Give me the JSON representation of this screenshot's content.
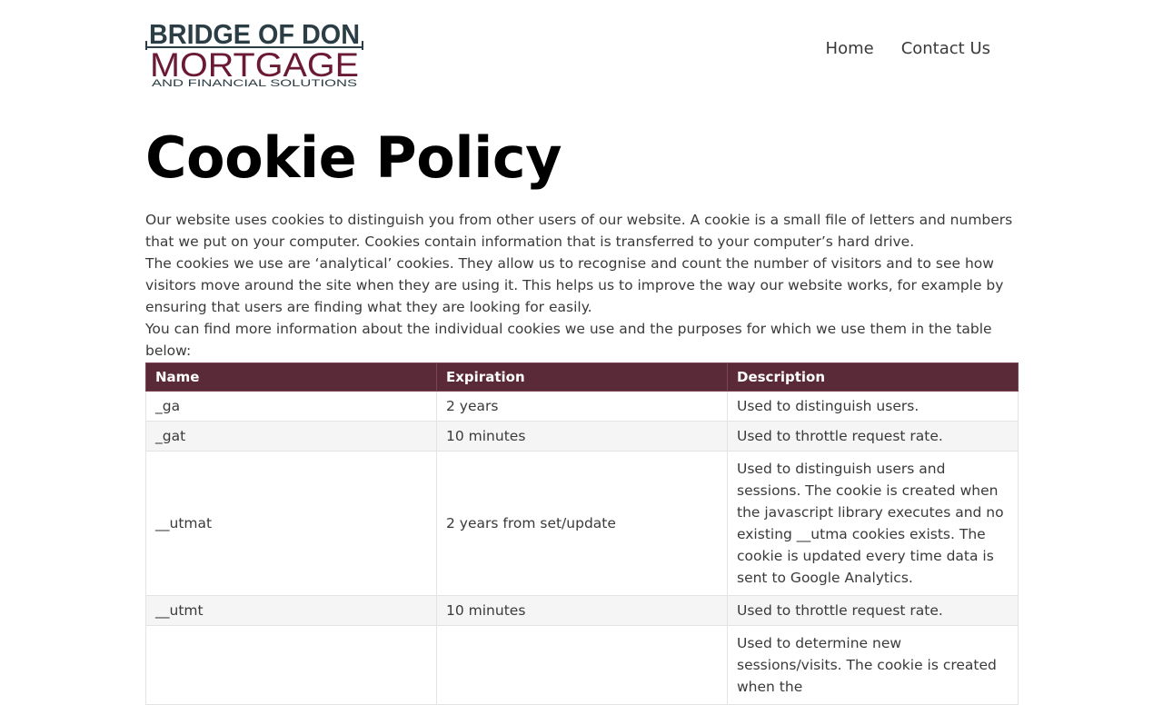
{
  "header": {
    "logo": {
      "line1": "BRIDGE OF DON",
      "line2": "MORTGAGE",
      "line3": "AND FINANCIAL SOLUTIONS",
      "colors": {
        "dark": "#2c3e45",
        "brand": "#6b1a33"
      }
    },
    "nav": [
      {
        "label": "Home"
      },
      {
        "label": "Contact Us"
      }
    ]
  },
  "main": {
    "title": "Cookie Policy",
    "paragraphs": [
      "Our website uses cookies to distinguish you from other users of our website. A cookie is a small file of letters and numbers that we put on your computer. Cookies contain information that is transferred to your computer’s hard drive.",
      "The cookies we use are ‘analytical’ cookies. They allow us to recognise and count the number of visitors and to see how visitors move around the site when they are using it. This helps us to improve the way our website works, for example by ensuring that users are finding what they are looking for easily.",
      "You can find more information about the individual cookies we use and the purposes for which we use them in the table below:"
    ],
    "table": {
      "header_color": "#5a2a38",
      "columns": [
        "Name",
        "Expiration",
        "Description"
      ],
      "rows": [
        [
          "_ga",
          "2 years",
          "Used to distinguish users."
        ],
        [
          "_gat",
          "10 minutes",
          "Used to throttle request rate."
        ],
        [
          "__utmat",
          "2 years from set/update",
          "Used to distinguish users and sessions. The cookie is created when the javascript library executes and no existing __utma cookies exists. The cookie is updated every time data is sent to Google Analytics."
        ],
        [
          "__utmt",
          "10 minutes",
          "Used to throttle request rate."
        ],
        [
          "",
          "",
          "Used to determine new sessions/visits. The cookie is created when the"
        ]
      ]
    }
  }
}
